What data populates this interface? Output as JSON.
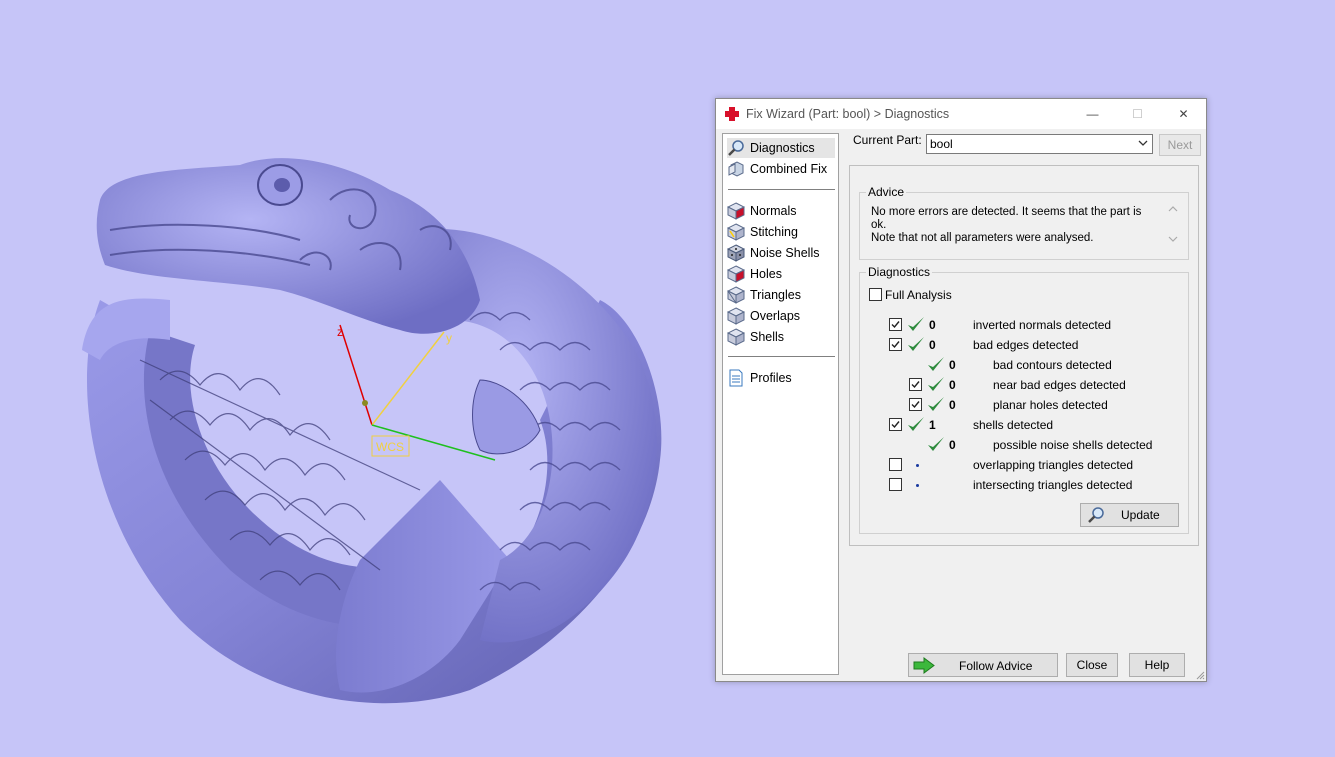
{
  "viewport": {
    "wcs_label": "WCS",
    "axis_y": "y",
    "axis_z": "z"
  },
  "window": {
    "title": "Fix Wizard (Part: bool) > Diagnostics",
    "minimize": "—",
    "maximize": "☐",
    "close": "✕"
  },
  "nav": {
    "top_items": [
      {
        "label": "Diagnostics",
        "icon": "magnifier-icon",
        "selected": true
      },
      {
        "label": "Combined Fix",
        "icon": "combined-fix-icon"
      }
    ],
    "fix_items": [
      {
        "label": "Normals",
        "icon": "normals-cube-icon"
      },
      {
        "label": "Stitching",
        "icon": "stitching-cube-icon"
      },
      {
        "label": "Noise Shells",
        "icon": "noise-shells-cube-icon"
      },
      {
        "label": "Holes",
        "icon": "holes-cube-icon"
      },
      {
        "label": "Triangles",
        "icon": "triangles-cube-icon"
      },
      {
        "label": "Overlaps",
        "icon": "overlaps-cube-icon"
      },
      {
        "label": "Shells",
        "icon": "shells-cube-icon"
      }
    ],
    "bottom_items": [
      {
        "label": "Profiles",
        "icon": "document-icon"
      }
    ]
  },
  "current_part": {
    "label": "Current Part:",
    "value": "bool",
    "next_label": "Next"
  },
  "advice": {
    "title": "Advice",
    "line1": "No more errors are detected. It seems that the part is ok.",
    "line2": "Note that not all parameters were analysed."
  },
  "diagnostics": {
    "title": "Diagnostics",
    "full_analysis_label": "Full Analysis",
    "full_analysis_checked": false,
    "rows": [
      {
        "indent": 0,
        "checkbox": true,
        "checked": true,
        "status": "ok",
        "count": "0",
        "label": "inverted normals detected"
      },
      {
        "indent": 0,
        "checkbox": true,
        "checked": true,
        "status": "ok",
        "count": "0",
        "label": "bad edges detected"
      },
      {
        "indent": 1,
        "checkbox": false,
        "checked": false,
        "status": "ok",
        "count": "0",
        "label": "bad contours detected"
      },
      {
        "indent": 1,
        "checkbox": true,
        "checked": true,
        "status": "ok",
        "count": "0",
        "label": "near bad edges detected"
      },
      {
        "indent": 1,
        "checkbox": true,
        "checked": true,
        "status": "ok",
        "count": "0",
        "label": "planar holes detected"
      },
      {
        "indent": 0,
        "checkbox": true,
        "checked": true,
        "status": "ok",
        "count": "1",
        "label": "shells detected"
      },
      {
        "indent": 1,
        "checkbox": false,
        "checked": false,
        "status": "ok",
        "count": "0",
        "label": "possible noise shells detected"
      },
      {
        "indent": 0,
        "checkbox": true,
        "checked": false,
        "status": "pending",
        "count": "",
        "label": "overlapping triangles detected"
      },
      {
        "indent": 0,
        "checkbox": true,
        "checked": false,
        "status": "pending",
        "count": "",
        "label": "intersecting triangles detected"
      }
    ],
    "update_label": "Update"
  },
  "footer": {
    "follow_advice_label": "Follow Advice",
    "close_label": "Close",
    "help_label": "Help"
  },
  "colors": {
    "background": "#c6c5f8",
    "model": "#8c8cdc",
    "check_green": "#2e8b3e",
    "axis_x": "#e00000",
    "axis_y": "#f0d040",
    "axis_green": "#1ec01e"
  }
}
